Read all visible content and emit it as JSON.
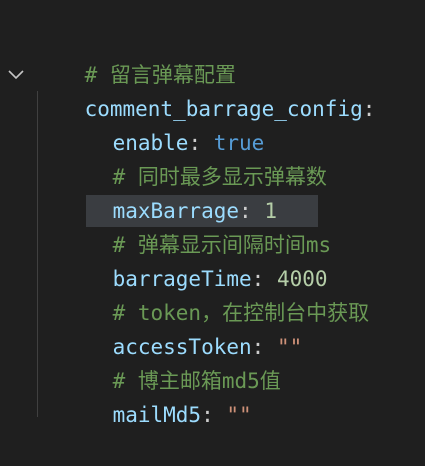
{
  "editor": {
    "lines": [
      {
        "comment": "# 留言弹幕配置"
      },
      {
        "key": "comment_barrage_config",
        "colon": ":"
      },
      {
        "key": "enable",
        "colon": ":",
        "value": "true"
      },
      {
        "comment": "# 同时最多显示弹幕数"
      },
      {
        "key": "maxBarrage",
        "colon": ":",
        "value": "1"
      },
      {
        "hash": "#",
        "comment": "弹幕显示间隔时间ms"
      },
      {
        "key": "barrageTime",
        "colon": ":",
        "value": "4000"
      },
      {
        "comment": "# token，在控制台中获取"
      },
      {
        "key": "accessToken",
        "colon": ":",
        "value": "\"\""
      },
      {
        "comment": "# 博主邮箱md5值"
      },
      {
        "key": "mailMd5",
        "colon": ":",
        "value": "\"\""
      }
    ],
    "colors": {
      "background": "#1f1f1f",
      "comment": "#6a9955",
      "key": "#9cdcfe",
      "boolean": "#569cd6",
      "number": "#b5cea8",
      "string": "#ce9178",
      "selection": "#3a3d41"
    },
    "fold_icon": "chevron-down-icon"
  }
}
